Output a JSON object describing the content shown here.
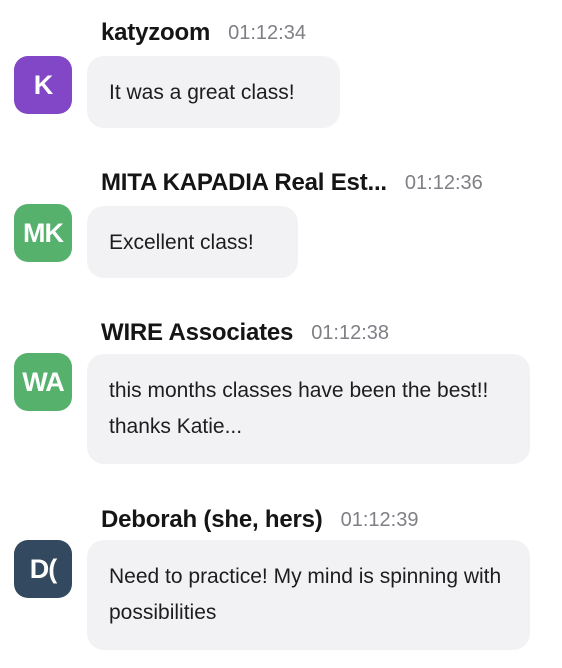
{
  "messages": [
    {
      "sender": "katyzoom",
      "time": "01:12:34",
      "avatar_initials": "K",
      "avatar_color": "#8147c6",
      "text": "It was a great class!"
    },
    {
      "sender": "MITA KAPADIA Real Est...",
      "time": "01:12:36",
      "avatar_initials": "MK",
      "avatar_color": "#55b16c",
      "text": "Excellent class!"
    },
    {
      "sender": "WIRE Associates",
      "time": "01:12:38",
      "avatar_initials": "WA",
      "avatar_color": "#55b16c",
      "text": "this months classes have been the best!! thanks Katie..."
    },
    {
      "sender": "Deborah (she, hers)",
      "time": "01:12:39",
      "avatar_initials": "D(",
      "avatar_color": "#33495f",
      "text": "Need to practice! My mind is spinning with possibilities"
    }
  ]
}
